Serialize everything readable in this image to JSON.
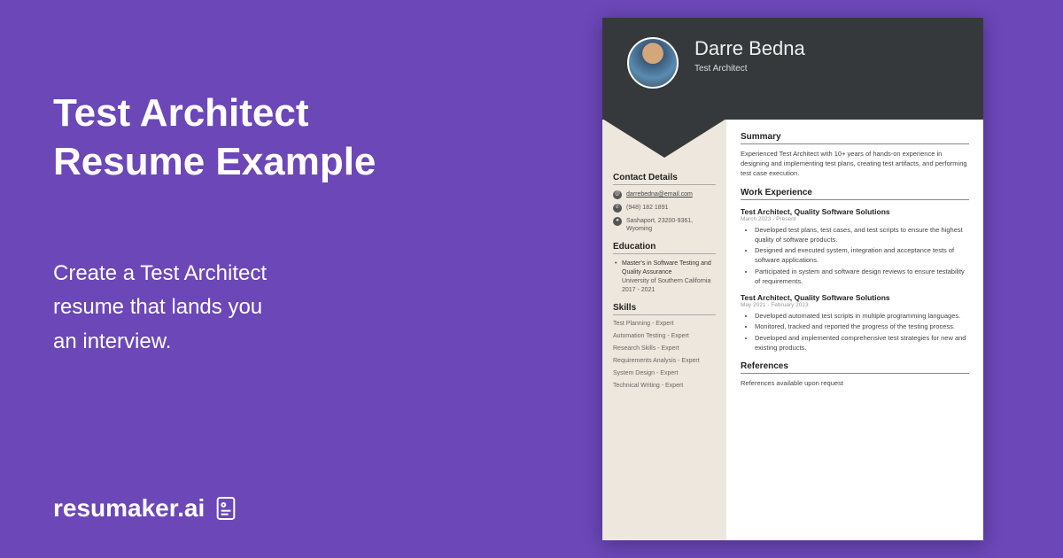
{
  "promo": {
    "title_line1": "Test Architect",
    "title_line2": "Resume Example",
    "subtitle_line1": "Create a Test Architect",
    "subtitle_line2": "resume that lands you",
    "subtitle_line3": "an interview.",
    "logo_text": "resumaker.ai"
  },
  "resume": {
    "name": "Darre Bedna",
    "role": "Test Architect",
    "contact": {
      "title": "Contact Details",
      "email": "darrebedna@email.com",
      "phone": "(948) 182 1891",
      "address": "Sashaport, 23200-9361, Wyoming"
    },
    "education": {
      "title": "Education",
      "degree": "Master's in Software Testing and Quality Assurance",
      "school": "University of Southern California",
      "years": "2017 - 2021"
    },
    "skills": {
      "title": "Skills",
      "items": [
        "Test Planning - Expert",
        "Automation Testing - Expert",
        "Research Skills - Expert",
        "Requirements Analysis - Expert",
        "System Design - Expert",
        "Technical Writing - Expert"
      ]
    },
    "summary": {
      "title": "Summary",
      "text": "Experienced Test Architect with 10+ years of hands-on experience in designing and implementing test plans, creating test artifacts, and performing test case execution."
    },
    "experience": {
      "title": "Work Experience",
      "jobs": [
        {
          "title": "Test Architect, Quality Software Solutions",
          "date": "March 2023 - Present",
          "bullets": [
            "Developed test plans, test cases, and test scripts to ensure the highest quality of software products.",
            "Designed and executed system, integration and acceptance tests of software applications.",
            "Participated in system and software design reviews to ensure testability of requirements."
          ]
        },
        {
          "title": "Test Architect, Quality Software Solutions",
          "date": "May 2021 - February 2023",
          "bullets": [
            "Developed automated test scripts in multiple programming languages.",
            "Monitored, tracked and reported the progress of the testing process.",
            "Developed and implemented comprehensive test strategies for new and existing products."
          ]
        }
      ]
    },
    "references": {
      "title": "References",
      "text": "References available upon request"
    }
  }
}
